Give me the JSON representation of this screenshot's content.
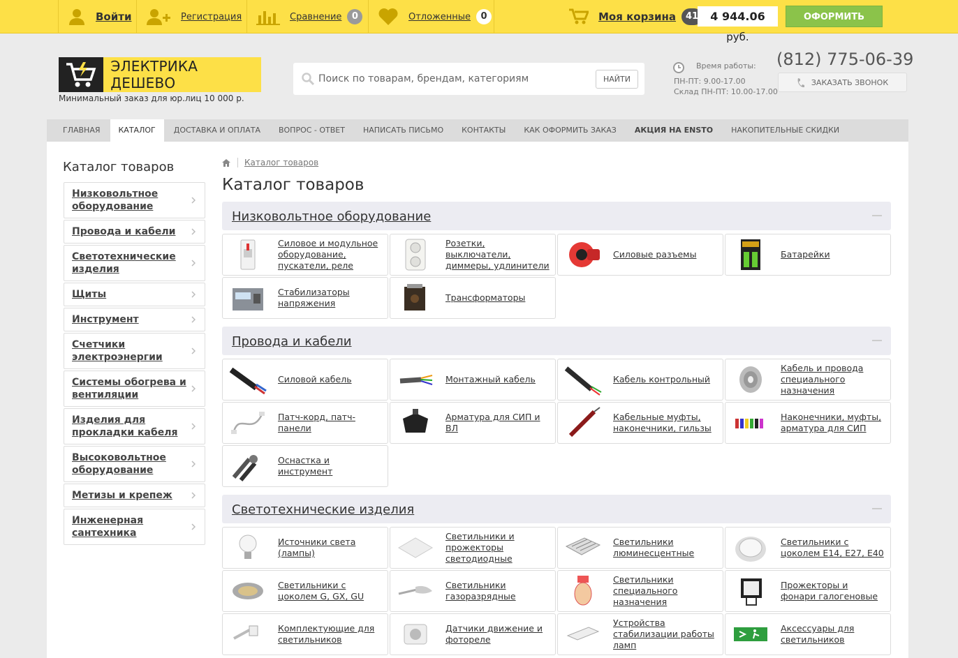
{
  "topbar": {
    "login": "Войти",
    "register": "Регистрация",
    "compare": "Сравнение",
    "compare_count": "0",
    "favorites": "Отложенные",
    "favorites_count": "0",
    "cart_label": "Моя корзина",
    "cart_count": "41",
    "cart_sum": "4 944.06",
    "cart_currency": "руб.",
    "checkout": "ОФОРМИТЬ"
  },
  "header": {
    "logo_text": "ЭЛЕКТРИКА ДЕШЕВО",
    "logo_sub": "Минимальный заказ для юр.лиц 10 000 р.",
    "search_placeholder": "Поиск по товарам, брендам, категориям",
    "search_button": "НАЙТИ",
    "work_title": "Время работы:",
    "work_line1": "ПН-ПТ: 9.00-17.00",
    "work_line2": "Склад ПН-ПТ: 10.00-17.00",
    "phone": "(812) 775-06-39",
    "callback": "ЗАКАЗАТЬ ЗВОНОК"
  },
  "nav": [
    "ГЛАВНАЯ",
    "КАТАЛОГ",
    "ДОСТАВКА И ОПЛАТА",
    "ВОПРОС - ОТВЕТ",
    "НАПИСАТЬ ПИСЬМО",
    "КОНТАКТЫ",
    "КАК ОФОРМИТЬ ЗАКАЗ",
    "АКЦИЯ НА ENSTO",
    "НАКОПИТЕЛЬНЫЕ СКИДКИ"
  ],
  "sidebar": {
    "title": "Каталог товаров",
    "items": [
      "Низковольтное оборудование",
      "Провода и кабели",
      "Светотехнические изделия",
      "Щиты",
      "Инструмент",
      "Счетчики электроэнергии",
      "Системы обогрева и вентиляции",
      "Изделия для прокладки кабеля",
      "Высоковольтное оборудование",
      "Метизы и крепеж",
      "Инженерная сантехника"
    ]
  },
  "breadcrumb": {
    "link": "Каталог товаров"
  },
  "main": {
    "title": "Каталог товаров",
    "sections": [
      {
        "title": "Низковольтное оборудование",
        "items": [
          "Силовое и модульное оборудование, пускатели, реле",
          "Розетки, выключатели, диммеры, удлинители",
          "Силовые разъемы",
          "Батарейки",
          "Стабилизаторы напряжения",
          "Трансформаторы"
        ]
      },
      {
        "title": "Провода и кабели",
        "items": [
          "Силовой кабель",
          "Монтажный кабель",
          "Кабель контрольный",
          "Кабель и провода специального назначения",
          "Патч-корд, патч-панели",
          "Арматура для СИП и ВЛ",
          "Кабельные муфты, наконечники, гильзы",
          "Наконечники, муфты, арматура для СИП",
          "Оснастка и инструмент"
        ]
      },
      {
        "title": "Светотехнические изделия",
        "items": [
          "Источники света (лампы)",
          "Светильники и прожекторы светодиодные",
          "Светильники люминесцентные",
          "Светильники с цоколем E14, E27, E40",
          "Светильники с цоколем G, GX, GU",
          "Светильники газоразрядные",
          "Светильники специального назначения",
          "Прожекторы и фонари галогеновые",
          "Комплектующие для светильников",
          "Датчики движение и фотореле",
          "Устройства стабилизации работы ламп",
          "Аксессуары для светильников"
        ]
      }
    ]
  }
}
